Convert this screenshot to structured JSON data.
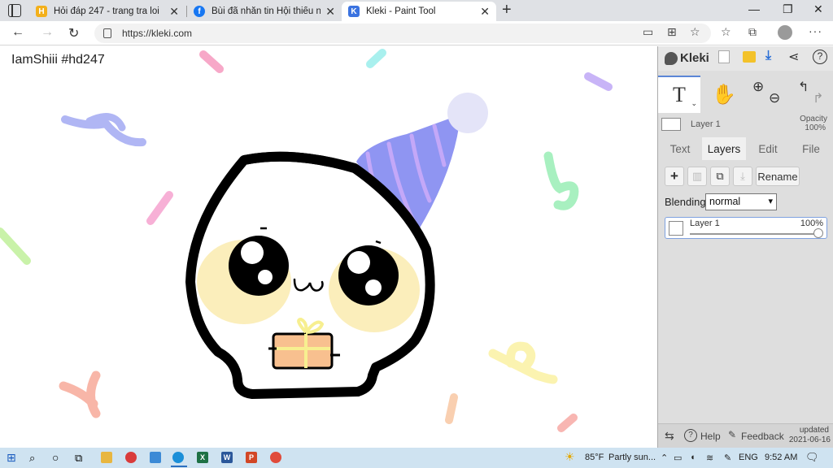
{
  "browser": {
    "tabs": [
      {
        "title": "Hỏi đáp 247 - trang tra loi",
        "favicon_color": "#f3b01b",
        "favicon_letter": "H"
      },
      {
        "title": "Bùi đã nhắn tin Hội thiểu năng Vi",
        "favicon_color": "#1877f2",
        "favicon_letter": "f"
      },
      {
        "title": "Kleki - Paint Tool",
        "favicon_color": "#3b73e0",
        "favicon_letter": "K"
      }
    ],
    "new_tab": "+",
    "close": "✕",
    "url": "https://kleki.com"
  },
  "canvas": {
    "watermark": "IamShiii #hd247"
  },
  "panel": {
    "logo": "Kleki",
    "current_layer": "Layer 1",
    "opacity_label": "Opacity",
    "opacity_value": "100%",
    "tabs": [
      "Text",
      "Layers",
      "Edit",
      "File"
    ],
    "rename": "Rename",
    "blending_label": "Blending",
    "blending_value": "normal",
    "layer": {
      "name": "Layer 1",
      "opacity": "100%",
      "opacity_fraction": 1.0
    },
    "help": "Help",
    "feedback": "Feedback",
    "updated_label": "updated",
    "updated_date": "2021-06-16"
  },
  "taskbar": {
    "temperature": "85°F",
    "weather": "Partly sun...",
    "language": "ENG",
    "time": "9:52 AM"
  },
  "colors": {
    "tabbar": "#dfe1e5",
    "panel": "#dedede",
    "taskbar": "#cfe3f1",
    "hat": "#8f95f2",
    "cheek": "#fbeebb",
    "gift": "#f8c08f"
  }
}
